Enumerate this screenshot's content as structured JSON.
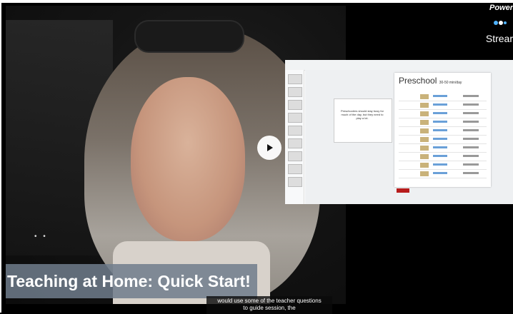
{
  "video": {
    "title_banner": "Teaching at Home: Quick Start!",
    "caption_lines": [
      "would use some of the teacher questions",
      "to guide session, the"
    ]
  },
  "shared_screen": {
    "document_heading": "Preschool",
    "document_subheading": "30-50 min/day",
    "arrow_note": "Preschoolers should stay busy for much of the day, but they need to play a lot."
  },
  "brand": {
    "power_text": "Power",
    "stream_text": "Strear"
  },
  "icons": {
    "play": "play-icon"
  }
}
